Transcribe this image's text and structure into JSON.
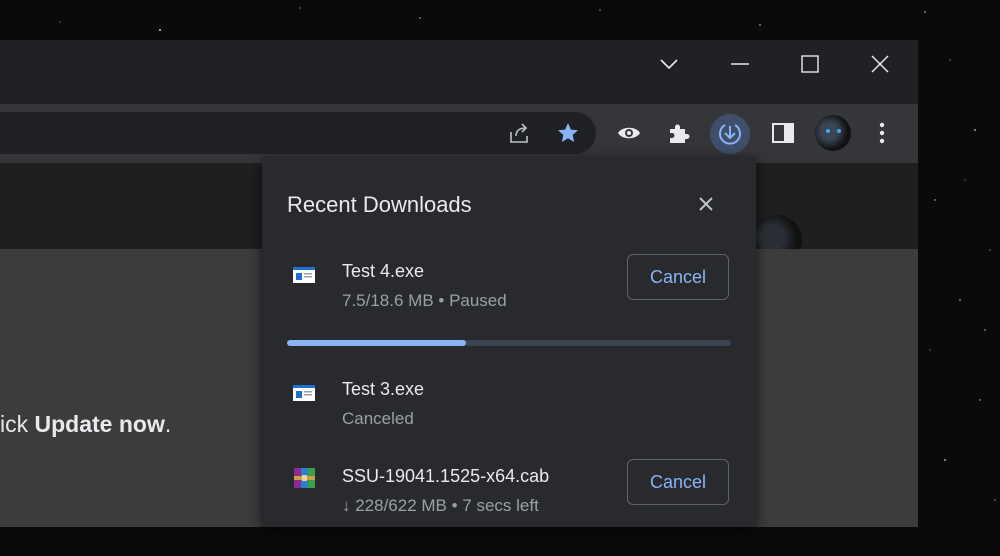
{
  "window_controls": {
    "dropdown_icon": "chevron-down-icon",
    "minimize_icon": "minimize-icon",
    "maximize_icon": "maximize-icon",
    "close_icon": "close-icon"
  },
  "toolbar": {
    "icons": [
      "share-icon",
      "star-icon",
      "eye-icon",
      "puzzle-icon",
      "download-icon",
      "side-panel-icon",
      "avatar",
      "menu-icon"
    ]
  },
  "page": {
    "text_prefix": "ick ",
    "text_bold": "Update now",
    "text_suffix": "."
  },
  "downloads_panel": {
    "title": "Recent Downloads",
    "items": [
      {
        "name": "Test 4.exe",
        "status": "7.5/18.6 MB • Paused",
        "button": "Cancel",
        "icon": "exe-file-icon",
        "progress": 0.403
      },
      {
        "name": "Test 3.exe",
        "status": "Canceled",
        "icon": "exe-file-icon"
      },
      {
        "name": "SSU-19041.1525-x64.cab",
        "status": "↓ 228/622 MB • 7 secs left",
        "button": "Cancel",
        "icon": "archive-file-icon"
      }
    ]
  },
  "colors": {
    "accent": "#8ab4f8",
    "panel_bg": "#292a2d",
    "titlebar_bg": "#202124",
    "toolbar_bg": "#35363a"
  }
}
